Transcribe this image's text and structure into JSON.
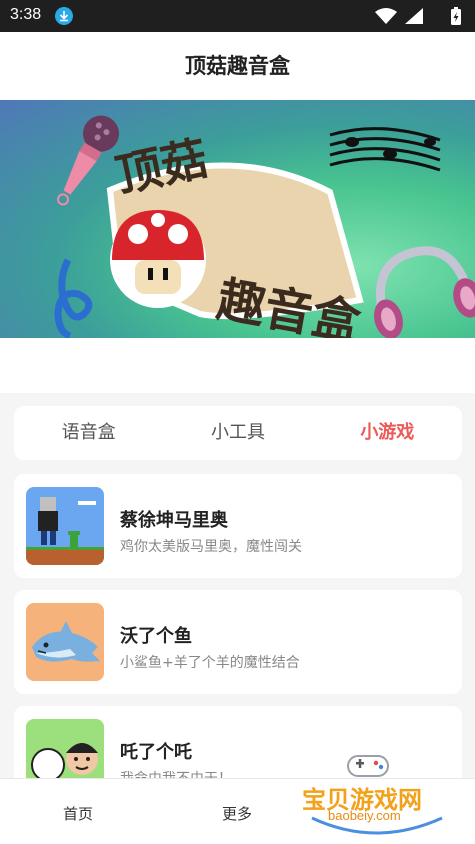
{
  "status_bar": {
    "time": "3:38",
    "download_icon": "download-icon",
    "wifi_icon": "wifi-icon",
    "signal_icon": "signal-icon",
    "battery_icon": "battery-charging-icon"
  },
  "header": {
    "title": "顶菇趣音盒"
  },
  "banner": {
    "text_line1": "顶菇",
    "text_line2": "趣音盒"
  },
  "tabs": [
    {
      "label": "语音盒",
      "active": false
    },
    {
      "label": "小工具",
      "active": false
    },
    {
      "label": "小游戏",
      "active": true
    }
  ],
  "games": [
    {
      "name": "蔡徐坤马里奥",
      "desc": "鸡你太美版马里奥，魔性闯关"
    },
    {
      "name": "沃了个鱼",
      "desc": "小鲨鱼+羊了个羊的魔性结合"
    },
    {
      "name": "吒了个吒",
      "desc": "我命由我不由天！"
    }
  ],
  "bottom_nav": [
    {
      "label": "首页"
    },
    {
      "label": "更多"
    }
  ],
  "watermark": {
    "text": "宝贝游戏网",
    "url": "baobeiy.com"
  },
  "colors": {
    "accent": "#ec5a5a",
    "status_bar": "#1f1f1f",
    "background": "#f5f5f5"
  }
}
